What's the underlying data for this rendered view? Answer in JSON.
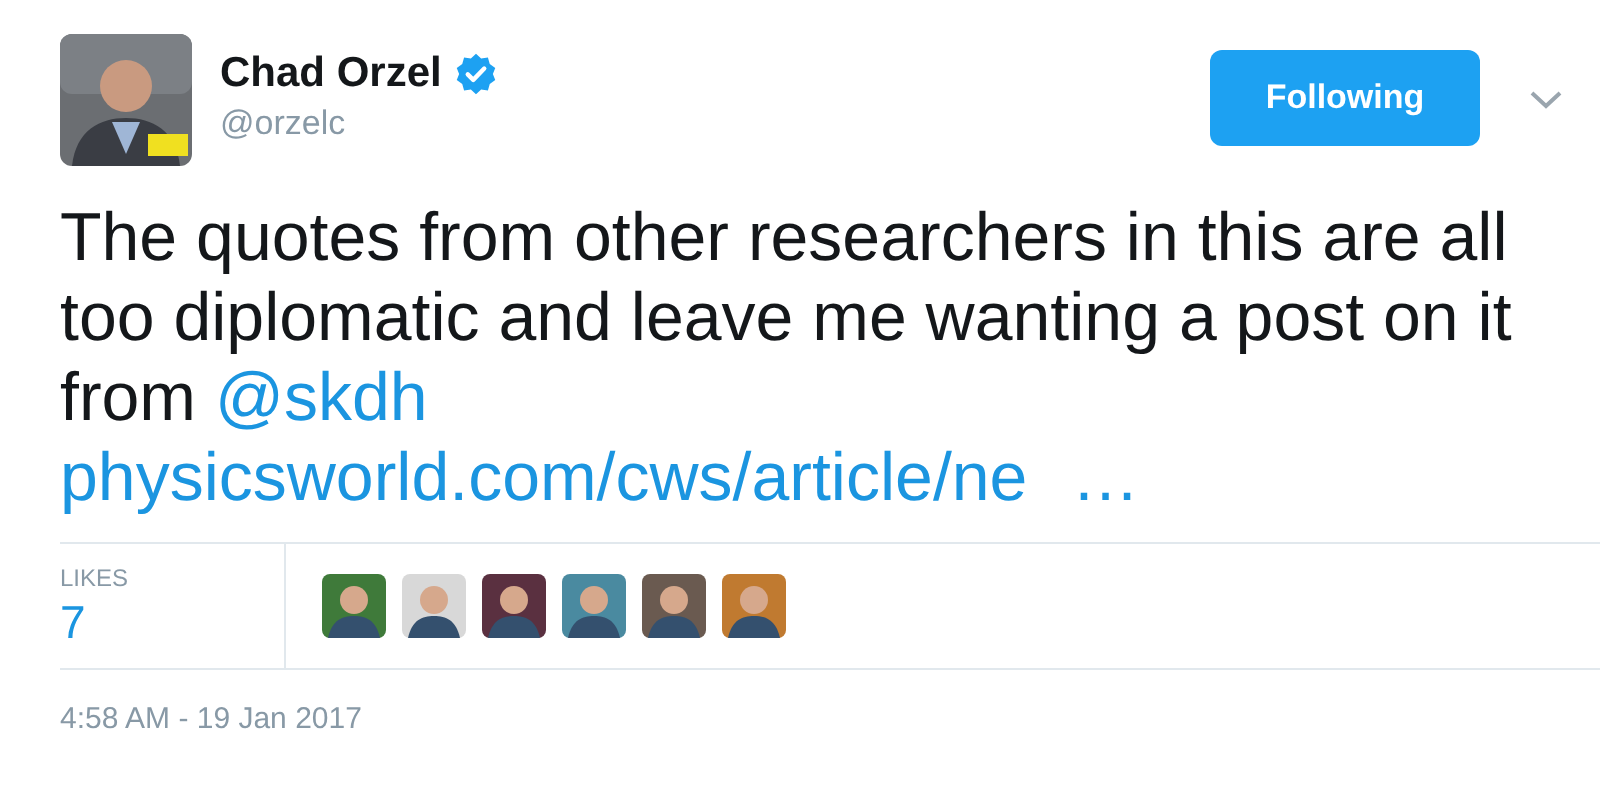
{
  "author": {
    "name": "Chad Orzel",
    "verified": true,
    "handle": "@orzelc"
  },
  "follow_button": {
    "label": "Following"
  },
  "tweet": {
    "text": "The quotes from other researchers in this are all too diplomatic and leave me wanting a post on it from ",
    "mention": "@skdh",
    "link": "physicsworld.com/cws/article/ne",
    "ellipsis": "…"
  },
  "likes": {
    "label": "LIKES",
    "count": "7"
  },
  "timestamp": "4:58 AM - 19 Jan 2017"
}
